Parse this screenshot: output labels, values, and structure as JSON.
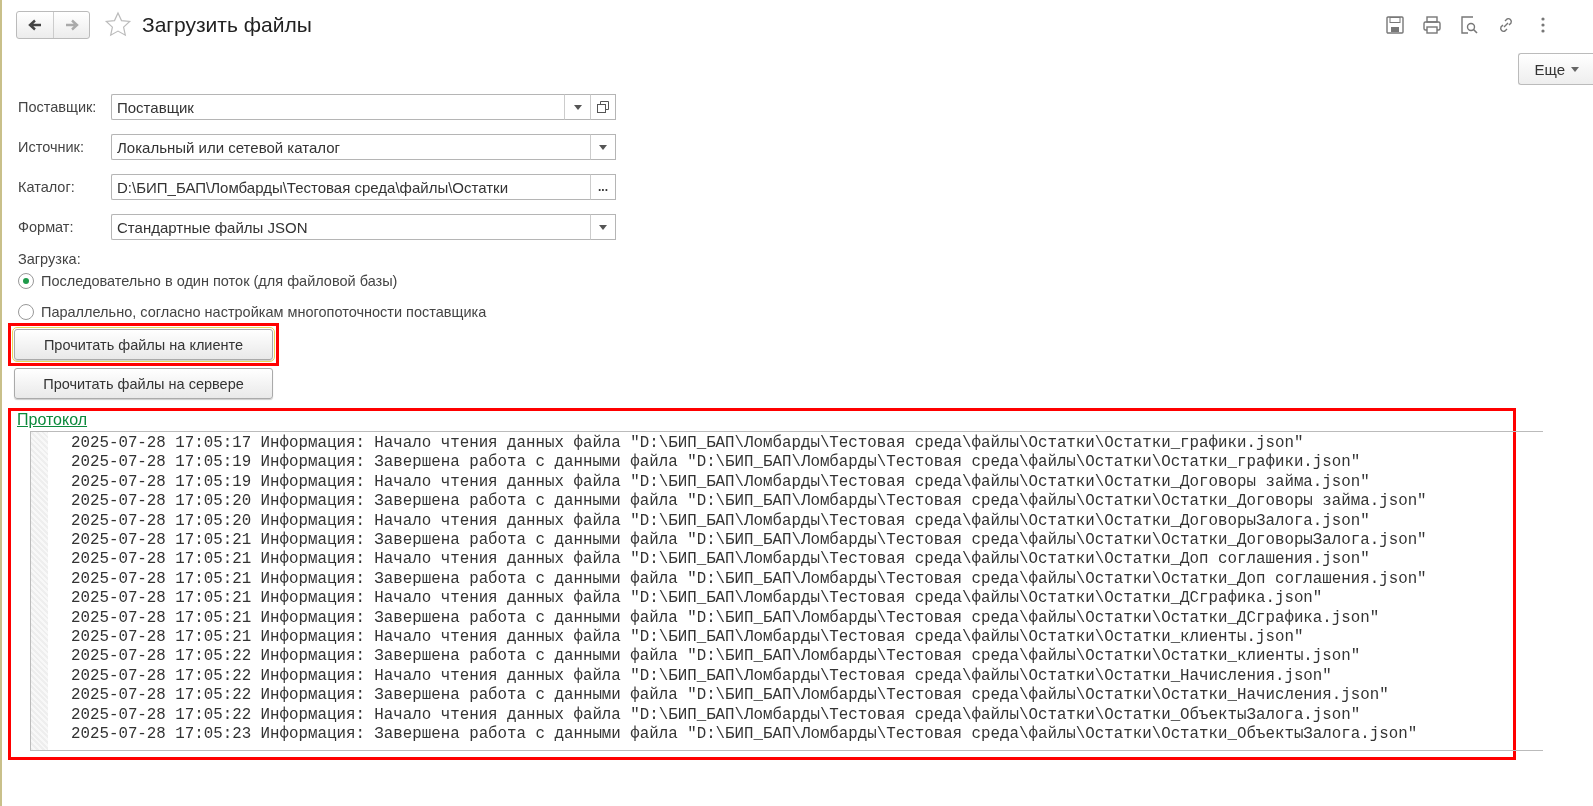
{
  "header": {
    "title": "Загрузить файлы",
    "more_button": "Еще"
  },
  "fields": [
    {
      "label": "Поставщик:",
      "value": "Поставщик",
      "kind": "select-open"
    },
    {
      "label": "Источник:",
      "value": "Локальный или сетевой каталог",
      "kind": "select"
    },
    {
      "label": "Каталог:",
      "value": "D:\\БИП_БАП\\Ломбарды\\Тестовая среда\\файлы\\Остатки",
      "kind": "browse",
      "button_text": "..."
    },
    {
      "label": "Формат:",
      "value": "Стандартные файлы JSON",
      "kind": "select"
    }
  ],
  "load_mode": {
    "label": "Загрузка:",
    "options": [
      {
        "label": "Последовательно в один поток (для файловой базы)",
        "selected": true
      },
      {
        "label": "Параллельно, согласно настройкам многопоточности поставщика",
        "selected": false
      }
    ]
  },
  "buttons": [
    {
      "label": "Прочитать файлы на клиенте",
      "highlighted": true
    },
    {
      "label": "Прочитать файлы на сервере",
      "highlighted": false
    }
  ],
  "protocol": {
    "title": "Протокол",
    "highlighted": true,
    "lines": [
      "2025-07-28 17:05:17 Информация: Начало чтения данных файла \"D:\\БИП_БАП\\Ломбарды\\Тестовая среда\\файлы\\Остатки\\Остатки_графики.json\"",
      "2025-07-28 17:05:19 Информация: Завершена работа с данными файла \"D:\\БИП_БАП\\Ломбарды\\Тестовая среда\\файлы\\Остатки\\Остатки_графики.json\"",
      "2025-07-28 17:05:19 Информация: Начало чтения данных файла \"D:\\БИП_БАП\\Ломбарды\\Тестовая среда\\файлы\\Остатки\\Остатки_Договоры займа.json\"",
      "2025-07-28 17:05:20 Информация: Завершена работа с данными файла \"D:\\БИП_БАП\\Ломбарды\\Тестовая среда\\файлы\\Остатки\\Остатки_Договоры займа.json\"",
      "2025-07-28 17:05:20 Информация: Начало чтения данных файла \"D:\\БИП_БАП\\Ломбарды\\Тестовая среда\\файлы\\Остатки\\Остатки_ДоговорыЗалога.json\"",
      "2025-07-28 17:05:21 Информация: Завершена работа с данными файла \"D:\\БИП_БАП\\Ломбарды\\Тестовая среда\\файлы\\Остатки\\Остатки_ДоговорыЗалога.json\"",
      "2025-07-28 17:05:21 Информация: Начало чтения данных файла \"D:\\БИП_БАП\\Ломбарды\\Тестовая среда\\файлы\\Остатки\\Остатки_Доп соглашения.json\"",
      "2025-07-28 17:05:21 Информация: Завершена работа с данными файла \"D:\\БИП_БАП\\Ломбарды\\Тестовая среда\\файлы\\Остатки\\Остатки_Доп соглашения.json\"",
      "2025-07-28 17:05:21 Информация: Начало чтения данных файла \"D:\\БИП_БАП\\Ломбарды\\Тестовая среда\\файлы\\Остатки\\Остатки_ДСграфика.json\"",
      "2025-07-28 17:05:21 Информация: Завершена работа с данными файла \"D:\\БИП_БАП\\Ломбарды\\Тестовая среда\\файлы\\Остатки\\Остатки_ДСграфика.json\"",
      "2025-07-28 17:05:21 Информация: Начало чтения данных файла \"D:\\БИП_БАП\\Ломбарды\\Тестовая среда\\файлы\\Остатки\\Остатки_клиенты.json\"",
      "2025-07-28 17:05:22 Информация: Завершена работа с данными файла \"D:\\БИП_БАП\\Ломбарды\\Тестовая среда\\файлы\\Остатки\\Остатки_клиенты.json\"",
      "2025-07-28 17:05:22 Информация: Начало чтения данных файла \"D:\\БИП_БАП\\Ломбарды\\Тестовая среда\\файлы\\Остатки\\Остатки_Начисления.json\"",
      "2025-07-28 17:05:22 Информация: Завершена работа с данными файла \"D:\\БИП_БАП\\Ломбарды\\Тестовая среда\\файлы\\Остатки\\Остатки_Начисления.json\"",
      "2025-07-28 17:05:22 Информация: Начало чтения данных файла \"D:\\БИП_БАП\\Ломбарды\\Тестовая среда\\файлы\\Остатки\\Остатки_ОбъектыЗалога.json\"",
      "2025-07-28 17:05:23 Информация: Завершена работа с данными файла \"D:\\БИП_БАП\\Ломбарды\\Тестовая среда\\файлы\\Остатки\\Остатки_ОбъектыЗалога.json\""
    ]
  }
}
